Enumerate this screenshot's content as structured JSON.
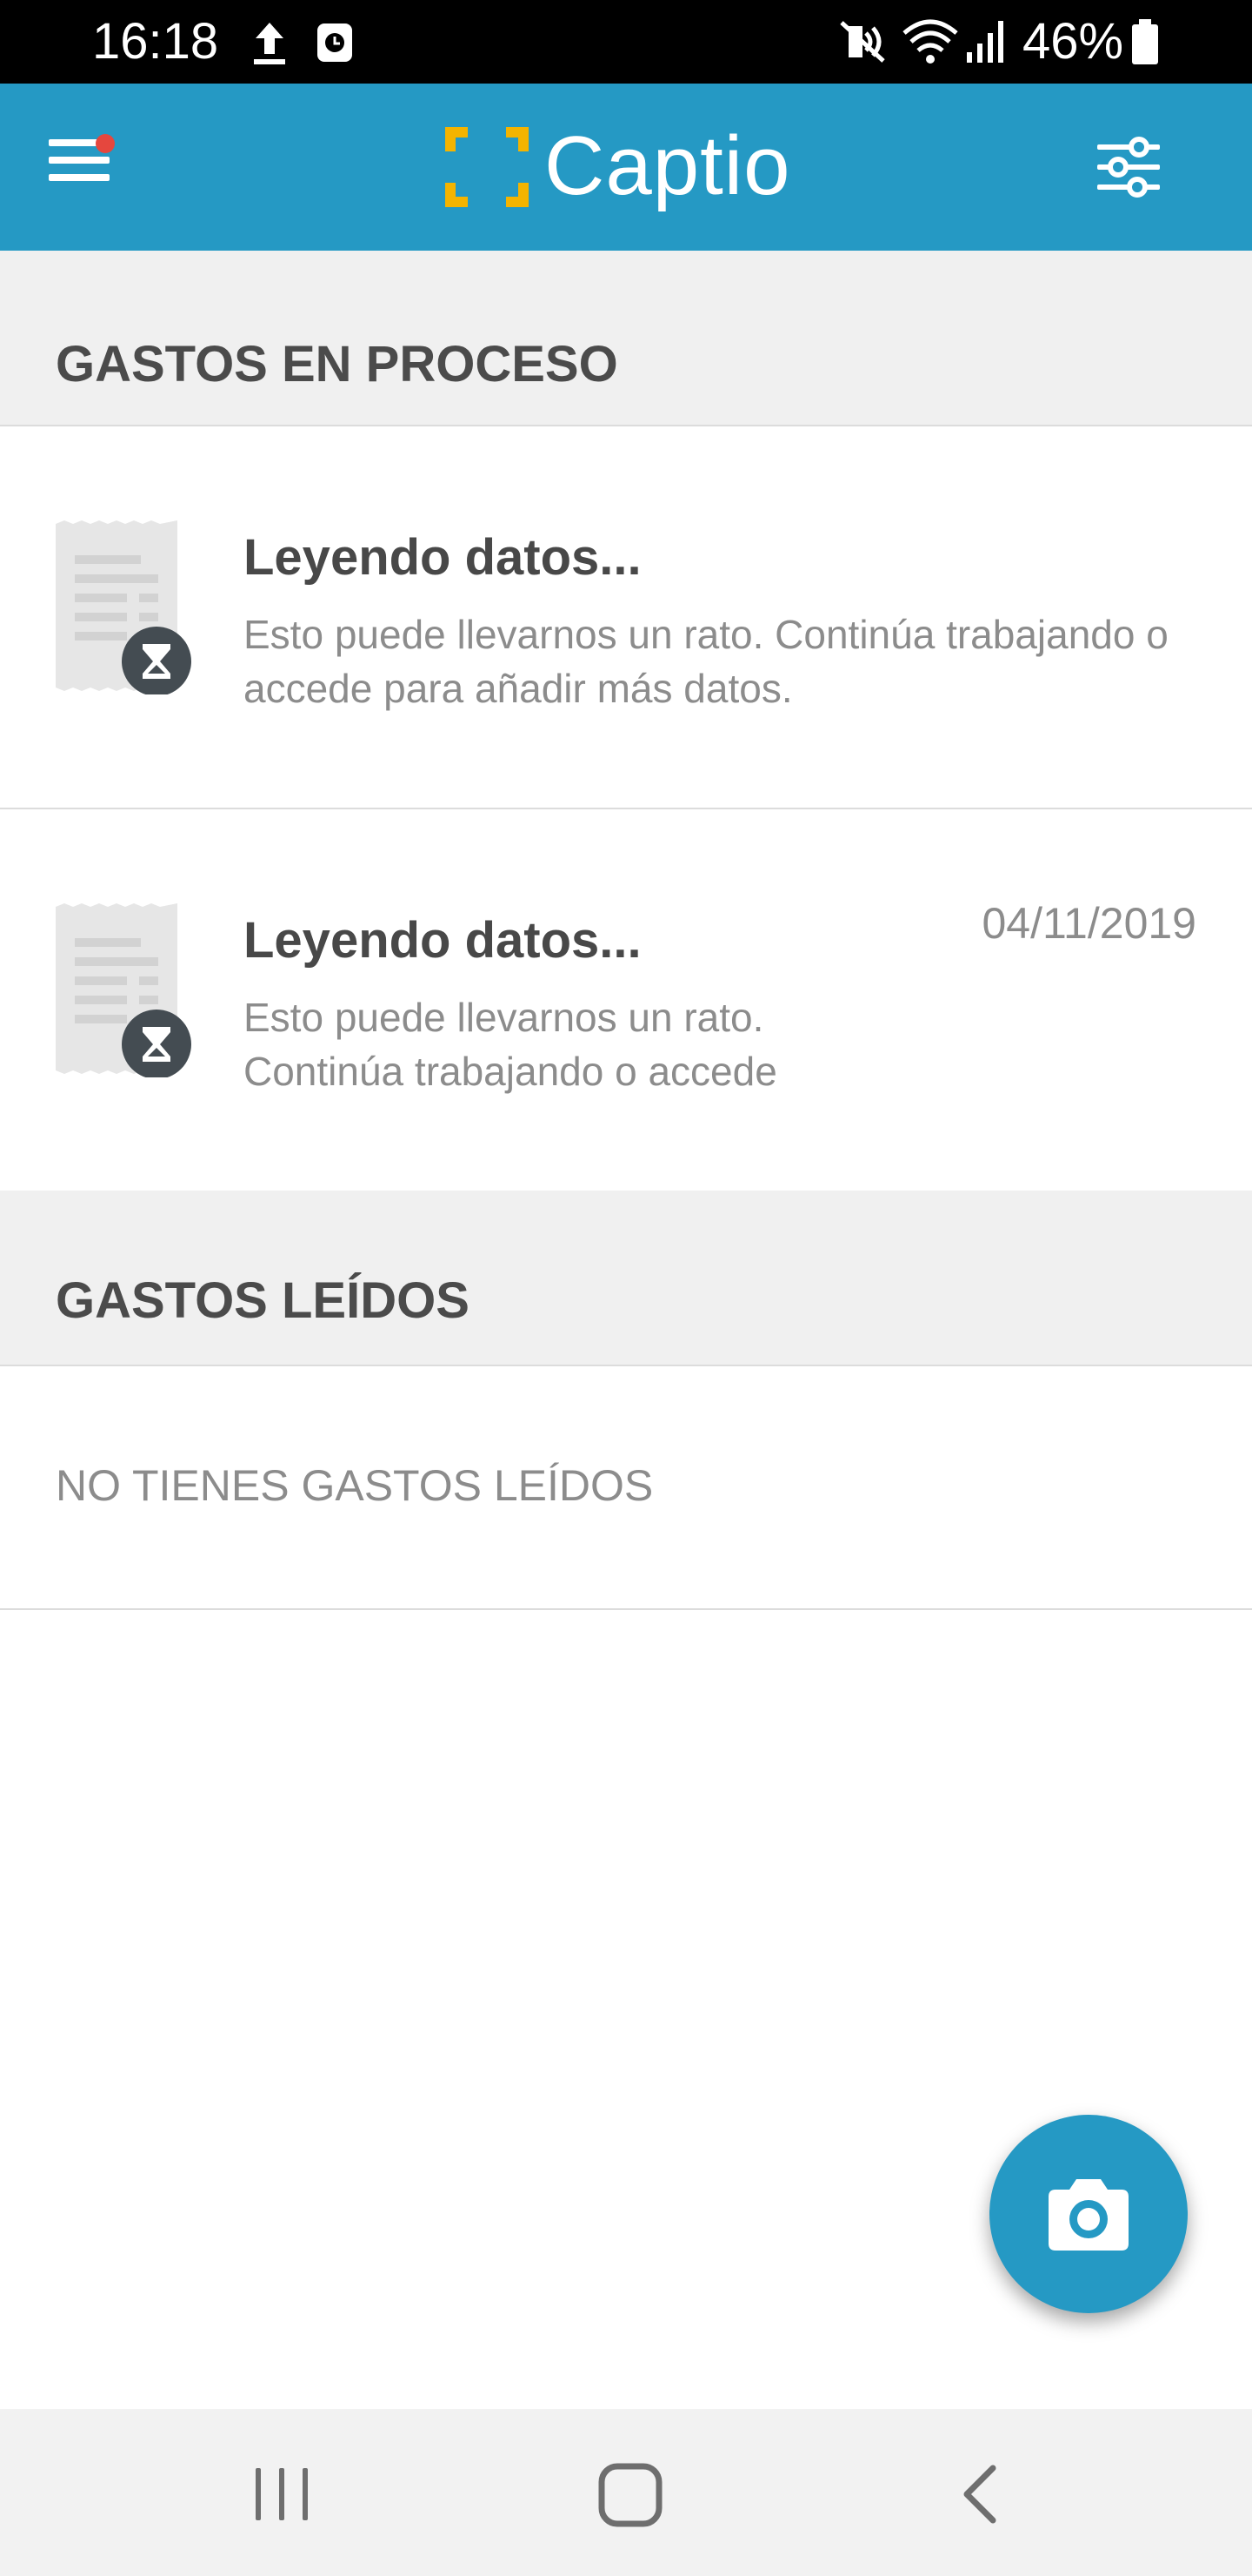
{
  "status_bar": {
    "time": "16:18",
    "battery": "46%",
    "icons": [
      "upload-icon",
      "alarm-icon",
      "mute-icon",
      "wifi-icon",
      "signal-icon",
      "battery-icon"
    ]
  },
  "app_bar": {
    "logo_text": "Captio",
    "menu_icon": "hamburger-menu-icon",
    "filter_icon": "sliders-icon",
    "colors": {
      "primary": "#2599c4",
      "logo_accent": "#f4b400",
      "notification_dot": "#e5473e"
    }
  },
  "sections": {
    "in_process": {
      "title": "GASTOS EN PROCESO",
      "items": [
        {
          "title": "Leyendo datos...",
          "description": "Esto puede llevarnos un rato. Continúa trabajando o accede para añadir más datos.",
          "date": ""
        },
        {
          "title": "Leyendo datos...",
          "description": "Esto puede llevarnos un rato. Continúa trabajando o accede",
          "date": "04/11/2019"
        }
      ]
    },
    "read": {
      "title": "GASTOS LEÍDOS",
      "empty_message": "NO TIENES GASTOS LEÍDOS"
    }
  },
  "fab": {
    "icon": "camera-icon"
  },
  "nav_bar": {
    "icons": [
      "recents-icon",
      "home-icon",
      "back-icon"
    ]
  }
}
